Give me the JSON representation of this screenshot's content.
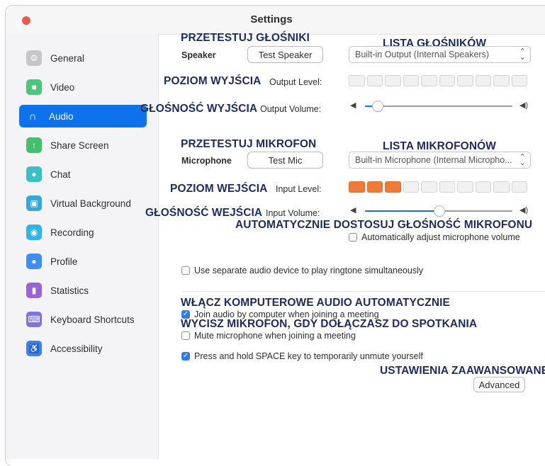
{
  "window": {
    "title": "Settings"
  },
  "sidebar": {
    "items": [
      {
        "label": "General",
        "icon": "gear-icon",
        "color": "#c6c6c6",
        "active": false
      },
      {
        "label": "Video",
        "icon": "video-camera-icon",
        "color": "#4cc77a",
        "active": false
      },
      {
        "label": "Audio",
        "icon": "headphones-icon",
        "color": "#0e72ed",
        "active": true
      },
      {
        "label": "Share Screen",
        "icon": "share-screen-icon",
        "color": "#44bf6e",
        "active": false
      },
      {
        "label": "Chat",
        "icon": "chat-bubble-icon",
        "color": "#38c1c4",
        "active": false
      },
      {
        "label": "Virtual Background",
        "icon": "virtual-background-icon",
        "color": "#35a9dd",
        "active": false
      },
      {
        "label": "Recording",
        "icon": "record-icon",
        "color": "#2fb6e6",
        "active": false
      },
      {
        "label": "Profile",
        "icon": "person-icon",
        "color": "#3d8df2",
        "active": false
      },
      {
        "label": "Statistics",
        "icon": "bar-chart-icon",
        "color": "#9b63d6",
        "active": false
      },
      {
        "label": "Keyboard Shortcuts",
        "icon": "keyboard-icon",
        "color": "#7f73dc",
        "active": false
      },
      {
        "label": "Accessibility",
        "icon": "accessibility-icon",
        "color": "#3f7fe6",
        "active": false
      }
    ]
  },
  "annotations": {
    "test_speakers": "PRZETESTUJ GŁOŚNIKI",
    "speaker_list": "LISTA GŁOŚNIKÓW",
    "output_level": "POZIOM WYJŚCIA",
    "output_volume": "GŁOŚNOŚĆ WYJŚCIA",
    "test_mic": "PRZETESTUJ MIKROFON",
    "mic_list": "LISTA MIKROFONÓW",
    "input_level": "POZIOM WEJŚCIA",
    "input_volume": "GŁOŚNOŚĆ WEJŚCIA",
    "auto_adjust": "AUTOMATYCZNIE DOSTOSUJ GŁOŚNOŚĆ MIKROFONU",
    "auto_join": "WŁĄCZ KOMPUTEROWE AUDIO AUTOMATYCZNIE",
    "mute_on_join": "WYCISZ MIKROFON, GDY DOŁĄCZASZ DO SPOTKANIA",
    "advanced": "USTAWIENIA ZAAWANSOWANE"
  },
  "speaker": {
    "label": "Speaker",
    "test_button": "Test Speaker",
    "device": "Built-in Output (Internal Speakers)",
    "output_level_label": "Output Level:",
    "output_level_active": 0,
    "output_volume_label": "Output Volume:",
    "output_volume_value": 0.05
  },
  "microphone": {
    "label": "Microphone",
    "test_button": "Test Mic",
    "device": "Built-in Microphone (Internal Micropho...",
    "input_level_label": "Input Level:",
    "input_level_active": 3,
    "input_volume_label": "Input Volume:",
    "input_volume_value": 0.5,
    "auto_adjust_label": "Automatically adjust microphone volume",
    "auto_adjust_checked": false
  },
  "options": {
    "separate_device": {
      "label": "Use separate audio device to play ringtone simultaneously",
      "checked": false
    },
    "join_audio": {
      "label": "Join audio by computer when joining a meeting",
      "checked": true
    },
    "mute_mic": {
      "label": "Mute microphone when joining a meeting",
      "checked": false
    },
    "space_unmute": {
      "label": "Press and hold SPACE key to temporarily unmute yourself",
      "checked": true
    }
  },
  "advanced_button": "Advanced",
  "meter_segments": 10
}
